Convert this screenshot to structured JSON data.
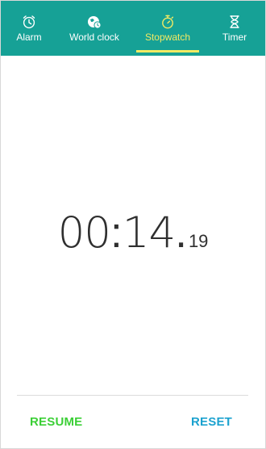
{
  "tabs": [
    {
      "label": "Alarm",
      "icon": "alarm-clock-icon"
    },
    {
      "label": "World clock",
      "icon": "globe-clock-icon"
    },
    {
      "label": "Stopwatch",
      "icon": "stopwatch-icon"
    },
    {
      "label": "Timer",
      "icon": "hourglass-icon"
    }
  ],
  "active_tab": "Stopwatch",
  "display": {
    "minutes": "00",
    "separator": ":",
    "seconds": "14",
    "dot": ".",
    "centiseconds": "19"
  },
  "actions": {
    "resume_label": "RESUME",
    "reset_label": "RESET"
  },
  "colors": {
    "tab_bar": "#16a196",
    "active_tab": "#f3ea63",
    "resume": "#3bcf36",
    "reset": "#1ca2cf"
  }
}
